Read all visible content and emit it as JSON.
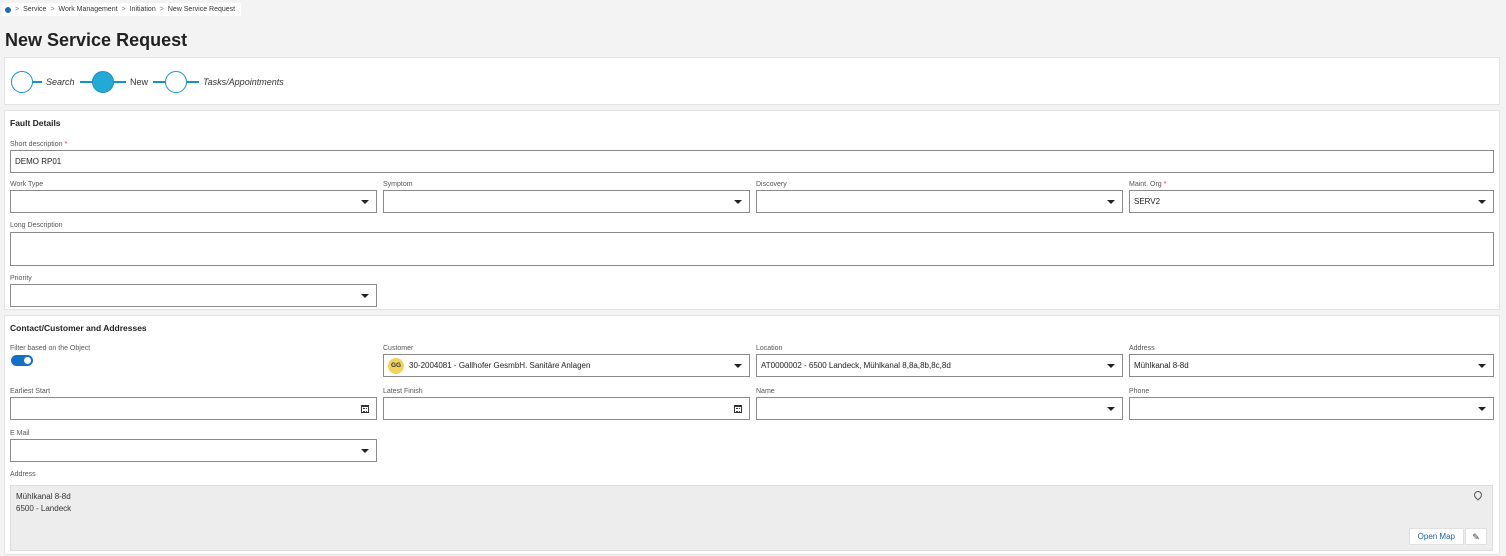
{
  "breadcrumb": {
    "items": [
      "Service",
      "Work Management",
      "Initiation",
      "New Service Request"
    ]
  },
  "page_title": "New Service Request",
  "stepper": {
    "steps": [
      {
        "label": "Search",
        "state": "inactive"
      },
      {
        "label": "New",
        "state": "active"
      },
      {
        "label": "Tasks/Appointments",
        "state": "inactive"
      }
    ]
  },
  "fault_details": {
    "title": "Fault Details",
    "short_description": {
      "label": "Short description",
      "required": "*",
      "value": "DEMO RP01"
    },
    "work_type": {
      "label": "Work Type",
      "value": ""
    },
    "symptom": {
      "label": "Symptom",
      "value": ""
    },
    "discovery": {
      "label": "Discovery",
      "value": ""
    },
    "maint_org": {
      "label": "Maint. Org",
      "required": "*",
      "value": "SERV2"
    },
    "long_description": {
      "label": "Long Description",
      "value": ""
    },
    "priority": {
      "label": "Priority",
      "value": ""
    }
  },
  "contact": {
    "title": "Contact/Customer and Addresses",
    "filter_toggle": {
      "label": "Filter based on the Object",
      "state": "on"
    },
    "customer": {
      "label": "Customer",
      "avatar": "GG",
      "value": "30-2004081 - Gallhofer GesmbH. Sanitäre Anlagen"
    },
    "location": {
      "label": "Location",
      "value": "AT0000002 - 6500 Landeck, Mühlkanal 8,8a,8b,8c,8d"
    },
    "address_select": {
      "label": "Address",
      "value": "Mühlkanal 8-8d"
    },
    "earliest_start": {
      "label": "Earliest Start",
      "value": ""
    },
    "latest_finish": {
      "label": "Latest Finish",
      "value": ""
    },
    "name": {
      "label": "Name",
      "value": ""
    },
    "phone": {
      "label": "Phone",
      "value": ""
    },
    "email": {
      "label": "E Mail",
      "value": ""
    },
    "address_display": {
      "label": "Address",
      "line1": "Mühlkanal 8-8d",
      "line2": "6500 - Landeck",
      "open_map": "Open Map"
    }
  },
  "icons": {
    "home": "home-icon",
    "dropdown": "chevron-down-icon",
    "calendar": "calendar-icon",
    "location": "map-pin-icon",
    "edit": "pencil-icon"
  },
  "colors": {
    "accent": "#1593c4",
    "active_step": "#22a9d6",
    "toggle": "#1570c7",
    "required": "#d32f2f",
    "link": "#1565a8",
    "avatar_bg": "#f3d35b"
  }
}
